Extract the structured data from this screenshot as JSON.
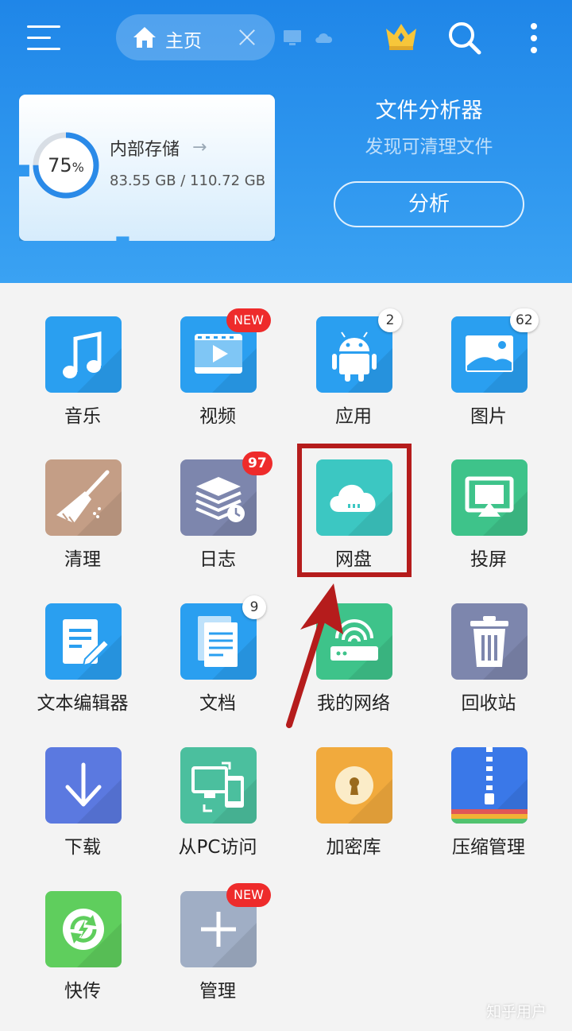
{
  "colors": {
    "header": "#2b93ee",
    "highlight": "#b51c1c",
    "badge_red": "#ee2b2b"
  },
  "header": {
    "tab_label": "主页",
    "storage": {
      "percent": "75",
      "percent_sign": "%",
      "name": "内部存储",
      "size": "83.55 GB / 110.72 GB"
    },
    "analyzer": {
      "title": "文件分析器",
      "subtitle": "发现可清理文件",
      "button": "分析"
    }
  },
  "grid": {
    "items": [
      {
        "label": "音乐",
        "icon": "music-icon",
        "color": "#2a9ff0"
      },
      {
        "label": "视频",
        "icon": "video-icon",
        "color": "#2a9ff0",
        "badge": "NEW"
      },
      {
        "label": "应用",
        "icon": "android-icon",
        "color": "#2a9ff0",
        "badge": "2"
      },
      {
        "label": "图片",
        "icon": "image-icon",
        "color": "#2a9ff0",
        "badge": "62"
      },
      {
        "label": "清理",
        "icon": "broom-icon",
        "color": "#c49e86"
      },
      {
        "label": "日志",
        "icon": "log-icon",
        "color": "#7d86ad",
        "badge": "97"
      },
      {
        "label": "网盘",
        "icon": "cloud-icon",
        "color": "#3cc7c2"
      },
      {
        "label": "投屏",
        "icon": "cast-icon",
        "color": "#3ec38a"
      },
      {
        "label": "文本编辑器",
        "icon": "edit-icon",
        "color": "#2a9ff0"
      },
      {
        "label": "文档",
        "icon": "document-icon",
        "color": "#2a9ff0",
        "badge": "9"
      },
      {
        "label": "我的网络",
        "icon": "router-icon",
        "color": "#3ec38a"
      },
      {
        "label": "回收站",
        "icon": "trash-icon",
        "color": "#7d86ad"
      },
      {
        "label": "下载",
        "icon": "download-icon",
        "color": "#5b79e0"
      },
      {
        "label": "从PC访问",
        "icon": "pc-access-icon",
        "color": "#4bbf9e"
      },
      {
        "label": "加密库",
        "icon": "lock-icon",
        "color": "#f1aa3d"
      },
      {
        "label": "压缩管理",
        "icon": "zip-icon",
        "color": "#3a78e8"
      },
      {
        "label": "快传",
        "icon": "sync-icon",
        "color": "#5fce5d"
      },
      {
        "label": "管理",
        "icon": "plus-icon",
        "color": "#a0aec5",
        "badge": "NEW"
      }
    ]
  },
  "watermark": "知乎用户"
}
